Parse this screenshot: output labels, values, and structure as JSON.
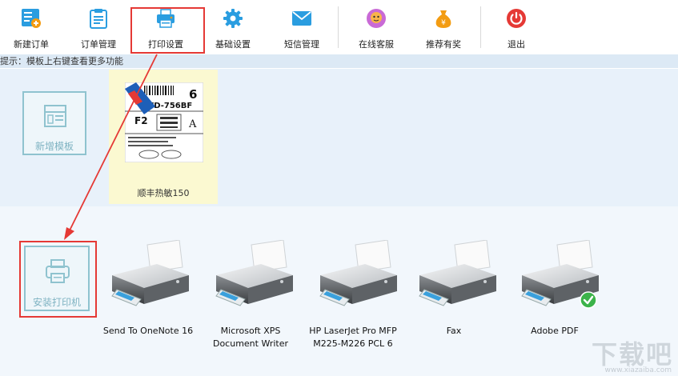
{
  "toolbar": {
    "items": [
      {
        "label": "新建订单",
        "icon": "new-order-icon"
      },
      {
        "label": "订单管理",
        "icon": "order-manage-icon"
      },
      {
        "label": "打印设置",
        "icon": "print-settings-icon"
      },
      {
        "label": "基础设置",
        "icon": "gear-icon"
      },
      {
        "label": "短信管理",
        "icon": "envelope-icon"
      },
      {
        "label": "在线客服",
        "icon": "customer-service-icon"
      },
      {
        "label": "推荐有奖",
        "icon": "money-bag-icon"
      },
      {
        "label": "退出",
        "icon": "power-icon"
      }
    ]
  },
  "hint": "提示：模板上右键查看更多功能",
  "templates": {
    "add_label": "新增模板",
    "items": [
      {
        "label": "顺丰热敏150"
      }
    ]
  },
  "printers": {
    "install_label": "安装打印机",
    "items": [
      {
        "name": "Send To OneNote 16"
      },
      {
        "name": "Microsoft XPS Document Writer"
      },
      {
        "name": "HP LaserJet Pro MFP M225-M226 PCL 6"
      },
      {
        "name": "Fax"
      },
      {
        "name": "Adobe PDF",
        "default": true
      }
    ]
  },
  "label_preview": {
    "big_char": "6",
    "code": "SWD-756BF",
    "zone": "F2",
    "grade": "A"
  },
  "watermark": {
    "text": "下载吧",
    "url": "www.xiazaiba.com"
  },
  "colors": {
    "accent": "#1e90d8",
    "highlight": "#e53935",
    "card_border": "#8fc3cf"
  }
}
